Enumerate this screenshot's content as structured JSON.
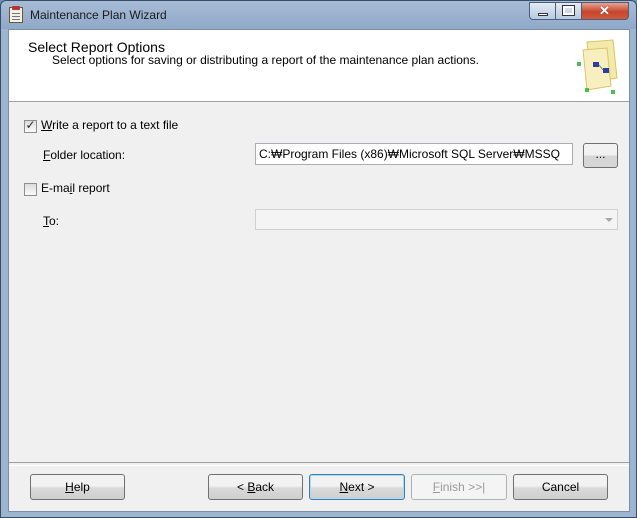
{
  "window": {
    "title": "Maintenance Plan Wizard",
    "minimize_label": "",
    "maximize_label": "",
    "close_label": "✕"
  },
  "header": {
    "title": "Select Report Options",
    "subtitle": "Select options for saving or distributing a report of the maintenance plan actions."
  },
  "options": {
    "write_report": {
      "mnemonic": "W",
      "label_rest": "rite a report to a text file",
      "checked": true
    },
    "folder_location": {
      "mnemonic": "F",
      "label_rest": "older location:",
      "value": "C:₩Program Files (x86)₩Microsoft SQL Server₩MSSQ",
      "browse_label": "..."
    },
    "email_report": {
      "label_pre": "E-ma",
      "mnemonic": "i",
      "label_rest": "l report",
      "checked": false
    },
    "to": {
      "mnemonic": "T",
      "label_rest": "o:",
      "value": ""
    }
  },
  "buttons": {
    "help": {
      "mnemonic": "H",
      "rest": "elp"
    },
    "back": {
      "prefix": "< ",
      "mnemonic": "B",
      "rest": "ack"
    },
    "next": {
      "mnemonic": "N",
      "rest": "ext >"
    },
    "finish": {
      "mnemonic": "F",
      "rest": "inish >>|"
    },
    "cancel": {
      "label": "Cancel"
    }
  },
  "colors": {
    "window_frame": "#9eb5d2",
    "dialog_bg": "#f0f0f0",
    "close_button": "#c7452d"
  }
}
